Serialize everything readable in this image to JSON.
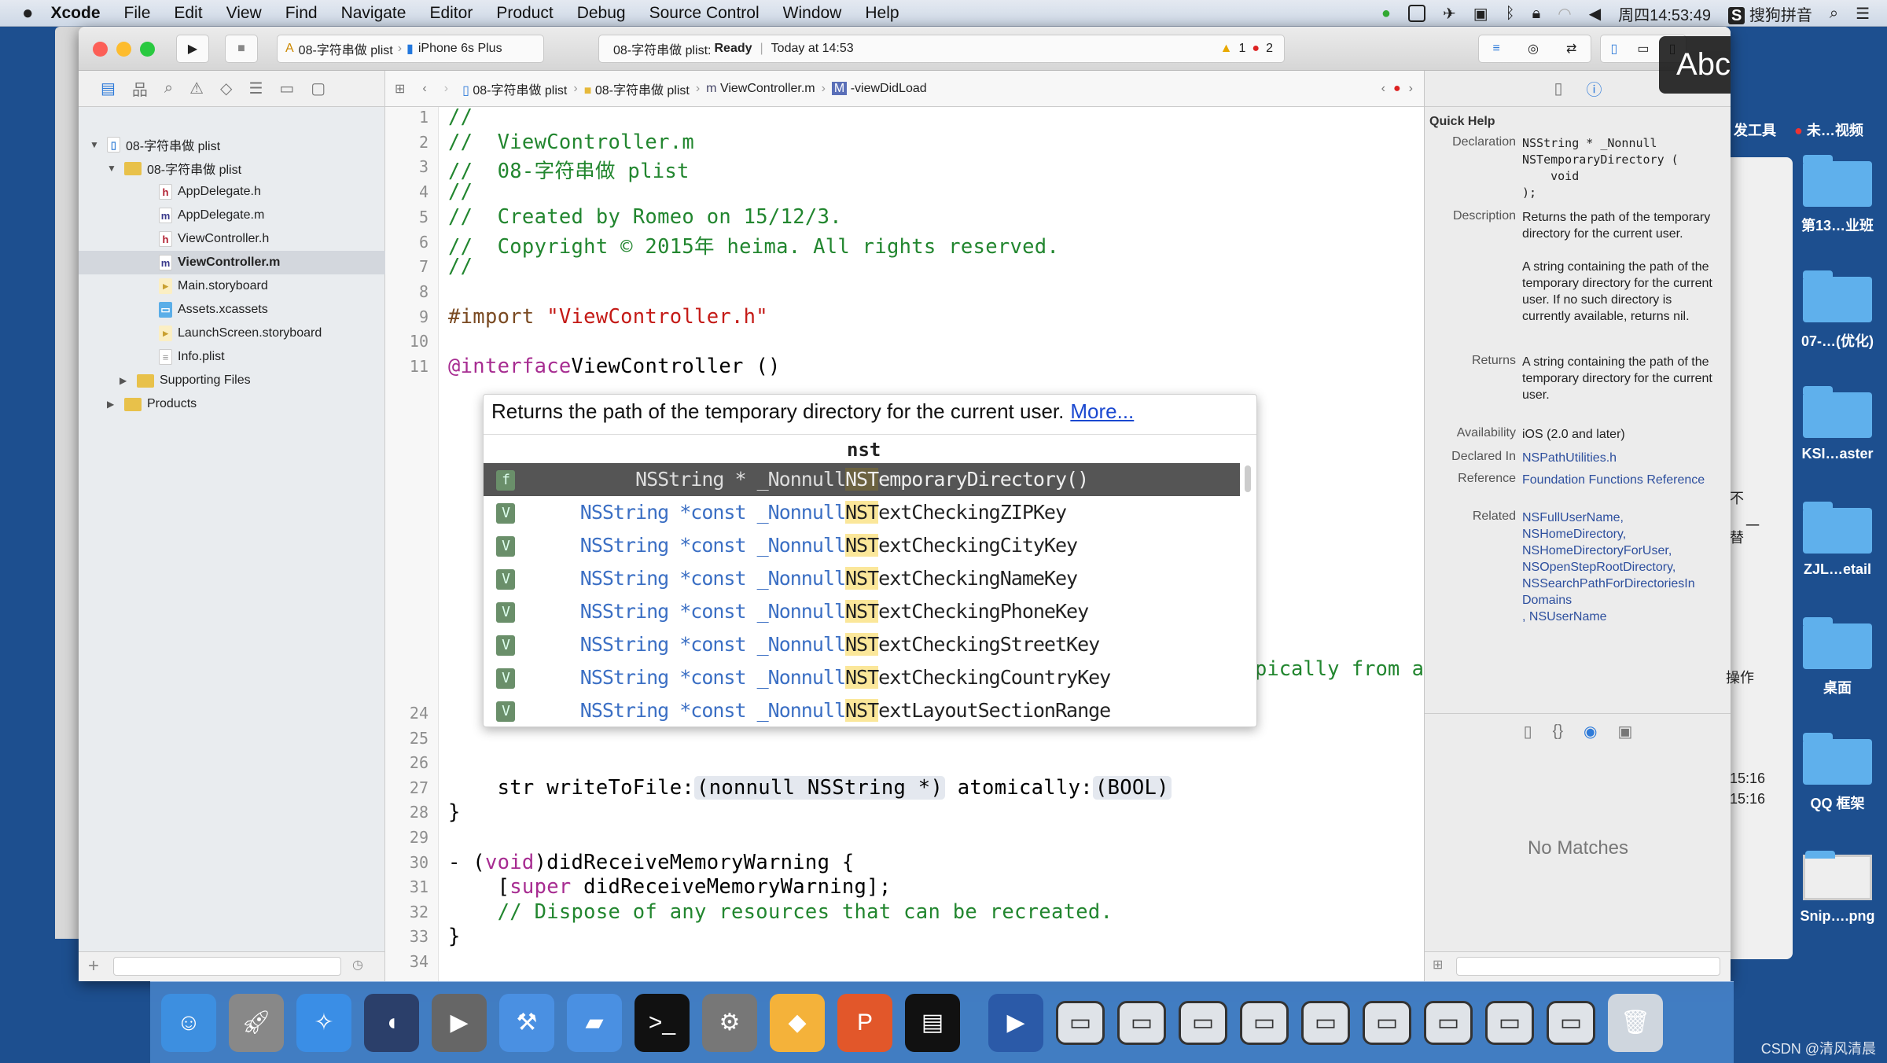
{
  "menubar": {
    "apple": "",
    "app": "Xcode",
    "items": [
      "File",
      "Edit",
      "View",
      "Find",
      "Navigate",
      "Editor",
      "Product",
      "Debug",
      "Source Control",
      "Window",
      "Help"
    ],
    "clock": "周四14:53:49",
    "input_method": "搜狗拼音"
  },
  "toolbar": {
    "scheme": "08-字符串做 plist",
    "device": "iPhone 6s Plus",
    "activity_project": "08-字符串做 plist:",
    "activity_status": "Ready",
    "activity_time": "Today at 14:53",
    "warnings": "1",
    "errors": "2",
    "overlay": "Abc"
  },
  "jumpbar": [
    "08-字符串做 plist",
    "08-字符串做 plist",
    "ViewController.m",
    "-viewDidLoad"
  ],
  "navigator": {
    "items": [
      {
        "label": "08-字符串做 plist",
        "level": 0,
        "icon": "project-icon",
        "disc": "▼"
      },
      {
        "label": "08-字符串做 plist",
        "level": 1,
        "icon": "folder-icon",
        "disc": "▼"
      },
      {
        "label": "AppDelegate.h",
        "level": 2,
        "icon": "header-file-icon"
      },
      {
        "label": "AppDelegate.m",
        "level": 2,
        "icon": "implementation-file-icon"
      },
      {
        "label": "ViewController.h",
        "level": 2,
        "icon": "header-file-icon"
      },
      {
        "label": "ViewController.m",
        "level": 2,
        "icon": "implementation-file-icon",
        "selected": true
      },
      {
        "label": "Main.storyboard",
        "level": 2,
        "icon": "storyboard-icon"
      },
      {
        "label": "Assets.xcassets",
        "level": 2,
        "icon": "assets-icon"
      },
      {
        "label": "LaunchScreen.storyboard",
        "level": 2,
        "icon": "storyboard-icon"
      },
      {
        "label": "Info.plist",
        "level": 2,
        "icon": "plist-icon"
      },
      {
        "label": "Supporting Files",
        "level": 1.5,
        "icon": "folder-icon",
        "disc": "▶"
      },
      {
        "label": "Products",
        "level": 1,
        "icon": "folder-icon",
        "disc": "▶"
      }
    ]
  },
  "code": {
    "lines": [
      {
        "n": 1,
        "s": [
          [
            "com",
            "//"
          ]
        ]
      },
      {
        "n": 2,
        "s": [
          [
            "com",
            "//  ViewController.m"
          ]
        ]
      },
      {
        "n": 3,
        "s": [
          [
            "com",
            "//  08-字符串做 plist"
          ]
        ]
      },
      {
        "n": 4,
        "s": [
          [
            "com",
            "//"
          ]
        ]
      },
      {
        "n": 5,
        "s": [
          [
            "com",
            "//  Created by Romeo on 15/12/3."
          ]
        ]
      },
      {
        "n": 6,
        "s": [
          [
            "com",
            "//  Copyright © 2015年 heima. All rights reserved."
          ]
        ]
      },
      {
        "n": 7,
        "s": [
          [
            "com",
            "//"
          ]
        ]
      },
      {
        "n": 8,
        "s": []
      },
      {
        "n": 9,
        "s": [
          [
            "pre",
            "#import "
          ],
          [
            "str",
            "\"ViewController.h\""
          ]
        ]
      },
      {
        "n": 10,
        "s": []
      },
      {
        "n": 11,
        "s": [
          [
            "kw",
            "@interface"
          ],
          [
            "",
            "ViewController ()"
          ]
        ]
      },
      {
        "n": 24,
        "s": [
          [
            "",
            "    NSString * tmpPath = NST"
          ],
          [
            "ph",
            "emporaryDirectory()"
          ]
        ]
      },
      {
        "n": 25,
        "s": []
      },
      {
        "n": 26,
        "s": []
      },
      {
        "n": 27,
        "s": [
          [
            "",
            "    str writeToFile:"
          ],
          [
            "tok",
            "(nonnull NSString *)"
          ],
          [
            "",
            " atomically:"
          ],
          [
            "tok",
            "(BOOL)"
          ]
        ]
      },
      {
        "n": 28,
        "s": [
          [
            "",
            "}"
          ]
        ]
      },
      {
        "n": 29,
        "s": []
      },
      {
        "n": 30,
        "s": [
          [
            "",
            "- ("
          ],
          [
            "kw",
            "void"
          ],
          [
            "",
            ")didReceiveMemoryWarning {"
          ]
        ]
      },
      {
        "n": 31,
        "s": [
          [
            "",
            "    ["
          ],
          [
            "kw",
            "super"
          ],
          [
            "",
            " didReceiveMemoryWarning];"
          ]
        ]
      },
      {
        "n": 32,
        "s": [
          [
            "com",
            "    // Dispose of any resources that can be recreated."
          ]
        ]
      },
      {
        "n": 33,
        "s": [
          [
            "",
            "}"
          ]
        ]
      },
      {
        "n": 34,
        "s": []
      }
    ],
    "hidden_fragment": "pically from a"
  },
  "autocomplete": {
    "description": "Returns the path of the temporary directory for the current user.",
    "more": "More...",
    "typed": "nst",
    "rows": [
      {
        "badge": "f",
        "type": "NSString * _Nonnull",
        "match": "NST",
        "rest": "emporaryDirectory()",
        "selected": true
      },
      {
        "badge": "V",
        "type": "NSString *const _Nonnull",
        "match": "NST",
        "rest": "extCheckingZIPKey"
      },
      {
        "badge": "V",
        "type": "NSString *const _Nonnull",
        "match": "NST",
        "rest": "extCheckingCityKey"
      },
      {
        "badge": "V",
        "type": "NSString *const _Nonnull",
        "match": "NST",
        "rest": "extCheckingNameKey"
      },
      {
        "badge": "V",
        "type": "NSString *const _Nonnull",
        "match": "NST",
        "rest": "extCheckingPhoneKey"
      },
      {
        "badge": "V",
        "type": "NSString *const _Nonnull",
        "match": "NST",
        "rest": "extCheckingStreetKey"
      },
      {
        "badge": "V",
        "type": "NSString *const _Nonnull",
        "match": "NST",
        "rest": "extCheckingCountryKey"
      },
      {
        "badge": "V",
        "type": "NSString *const _Nonnull",
        "match": "NST",
        "rest": "extLayoutSectionRange"
      }
    ]
  },
  "quick_help": {
    "title": "Quick Help",
    "rows": [
      {
        "label": "Declaration",
        "value": "NSString * _Nonnull\nNSTemporaryDirectory (\n    void\n);",
        "style": "mono"
      },
      {
        "label": "Description",
        "value": "Returns the path of the temporary directory for the current user.\n\nA string containing the path of the temporary directory for the current user. If no such directory is currently available, returns nil."
      },
      {
        "label": "Returns",
        "value": "A string containing the path of the temporary directory for the current user."
      },
      {
        "label": "Availability",
        "value": "iOS (2.0 and later)"
      },
      {
        "label": "Declared In",
        "value": "NSPathUtilities.h",
        "style": "link"
      },
      {
        "label": "Reference",
        "value": "Foundation Functions Reference",
        "style": "link"
      },
      {
        "label": "Related",
        "value": "NSFullUserName,\nNSHomeDirectory,\nNSHomeDirectoryForUser,\nNSOpenStepRootDirectory,\nNSSearchPathForDirectoriesIn\nDomains\n, NSUserName",
        "style": "link"
      }
    ]
  },
  "library": {
    "empty": "No Matches"
  },
  "background_window": {
    "fragments": [
      "不",
      "一",
      "替",
      "操作",
      "15:16",
      "15:16"
    ]
  },
  "desktop": {
    "top_labels": [
      "发工具",
      "未…视频"
    ],
    "items": [
      "第13…业班",
      "07-…(优化)",
      "KSI…aster",
      "ZJL…etail",
      "桌面",
      "QQ 框架",
      "Snip….png"
    ]
  },
  "dock": {
    "items": [
      "finder-icon",
      "launchpad-icon",
      "safari-icon",
      "mouse-app-icon",
      "video-icon",
      "xcode-icon",
      "instruments-icon",
      "terminal-icon",
      "system-preferences-icon",
      "sketch-icon",
      "powerpoint-icon",
      "console-icon",
      "quicktime-icon",
      "screen-1",
      "screen-2",
      "screen-3",
      "screen-4",
      "screen-5",
      "screen-6",
      "screen-7",
      "screen-8",
      "screen-9",
      "trash-icon"
    ]
  },
  "watermark": "CSDN @清风清晨",
  "colors": {
    "comment": "#22862f",
    "keyword": "#a72c91",
    "string": "#c41a16",
    "desktop": "#1d4f8f",
    "selection": "#555555"
  }
}
